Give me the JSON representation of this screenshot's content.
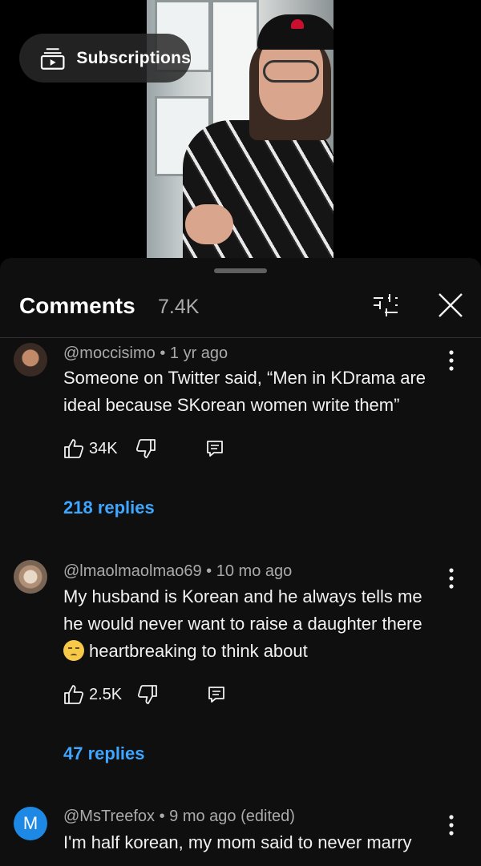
{
  "overlay": {
    "subscriptions_label": "Subscriptions"
  },
  "header": {
    "title": "Comments",
    "count": "7.4K"
  },
  "comments": [
    {
      "author": "@moccisimo",
      "age": "1 yr ago",
      "text": "Someone on Twitter said, “Men in KDrama are ideal because SKorean women write them”",
      "likes": "34K",
      "replies": "218 replies"
    },
    {
      "author": "@lmaolmaolmao69",
      "age": "10 mo ago",
      "text_line1": "My husband is Korean and he always tells me",
      "text_line2": "he would never want to raise a daughter there",
      "text_line3": "heartbreaking to think about",
      "emoji": "pensive-face-emoji",
      "likes": "2.5K",
      "replies": "47 replies"
    },
    {
      "author": "@MsTreefox",
      "age": "9 mo ago (edited)",
      "avatar_letter": "M",
      "text": "I'm half korean, my mom said to never marry"
    }
  ],
  "separator": " • ",
  "colors": {
    "link": "#3ea6ff",
    "sheet_bg": "#0f0f0f",
    "avatar_m": "#1e88e5"
  },
  "icons": [
    "subscriptions-icon",
    "filter-icon",
    "close-icon",
    "more-vert-icon",
    "thumb-up-icon",
    "thumb-down-icon",
    "reply-icon"
  ]
}
